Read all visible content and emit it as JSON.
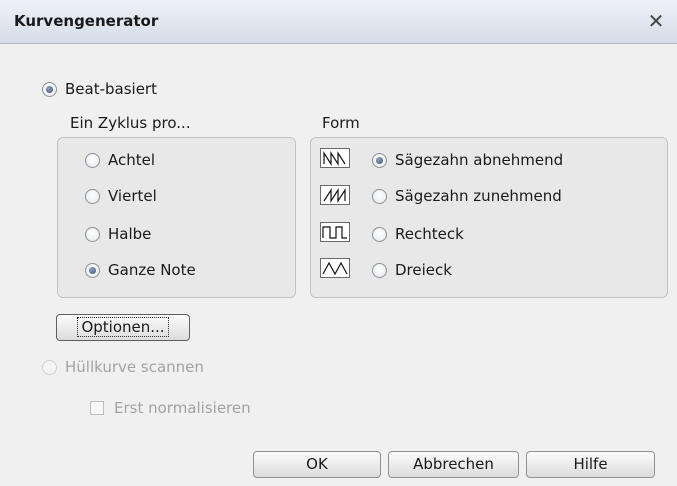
{
  "dialog": {
    "title": "Kurvengenerator",
    "close_symbol": "✕"
  },
  "mode": {
    "beat_based_label": "Beat-basiert",
    "beat_based_selected": true
  },
  "cycle": {
    "caption": "Ein Zyklus pro...",
    "options": [
      {
        "label": "Achtel",
        "selected": false
      },
      {
        "label": "Viertel",
        "selected": false
      },
      {
        "label": "Halbe",
        "selected": false
      },
      {
        "label": "Ganze Note",
        "selected": true
      }
    ]
  },
  "form": {
    "caption": "Form",
    "options": [
      {
        "label": "Sägezahn abnehmend",
        "selected": true,
        "icon": "sawtooth-down-icon"
      },
      {
        "label": "Sägezahn zunehmend",
        "selected": false,
        "icon": "sawtooth-up-icon"
      },
      {
        "label": "Rechteck",
        "selected": false,
        "icon": "square-wave-icon"
      },
      {
        "label": "Dreieck",
        "selected": false,
        "icon": "triangle-wave-icon"
      }
    ]
  },
  "buttons": {
    "options": "Optionen...",
    "ok": "OK",
    "cancel": "Abbrechen",
    "help": "Hilfe"
  },
  "envelope": {
    "scan_label": "Hüllkurve scannen",
    "scan_enabled": false,
    "normalize_label": "Erst normalisieren",
    "normalize_enabled": false
  }
}
